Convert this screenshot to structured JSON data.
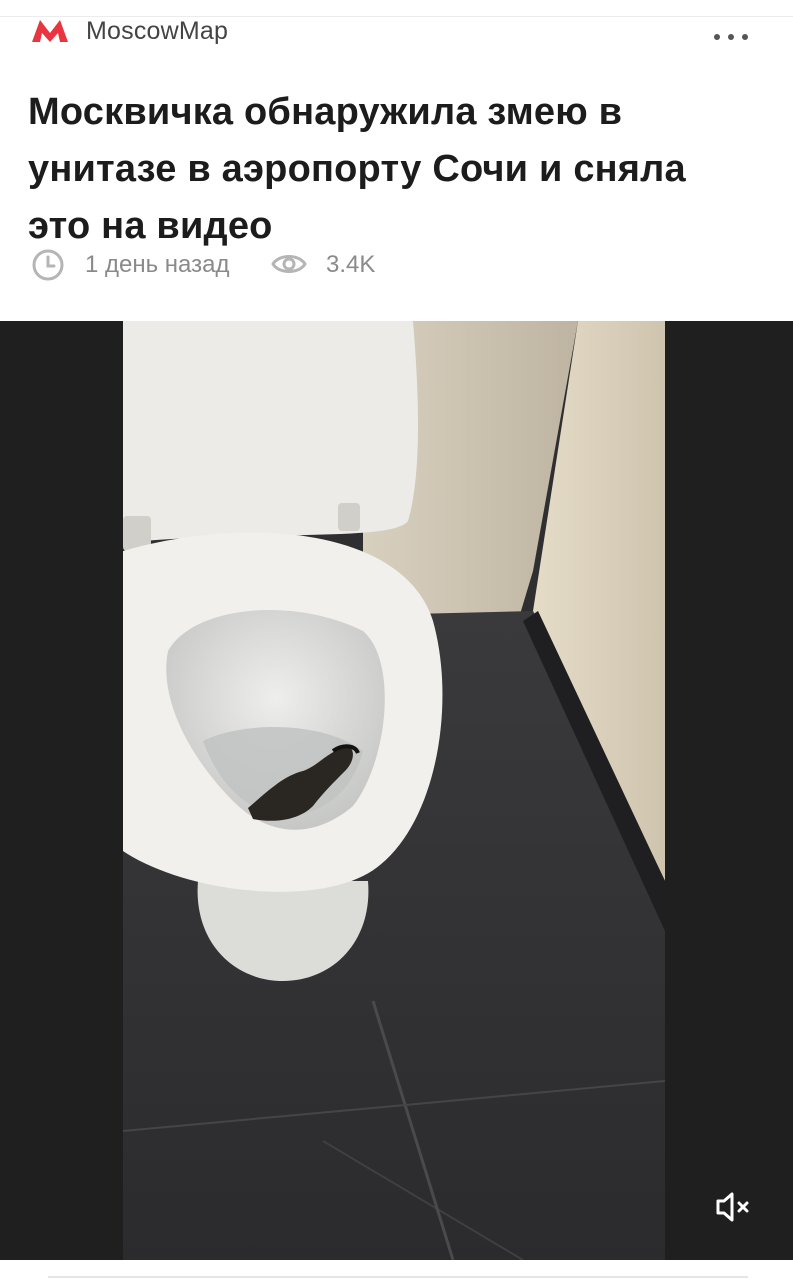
{
  "header": {
    "brand_name": "MoscowMap",
    "logo_icon": "moscow-metro-m-icon",
    "logo_color": "#e8353f",
    "more_icon": "more-dots-icon"
  },
  "article": {
    "title": "Москвичка обнаружила змею в унитазе в аэропорту Сочи и сняла это на видео",
    "time_icon": "clock-icon",
    "published": "1 день назад",
    "views_icon": "eye-icon",
    "views": "3.4K"
  },
  "video": {
    "mute_icon": "speaker-muted-icon",
    "background_color": "#1f1f1f"
  }
}
